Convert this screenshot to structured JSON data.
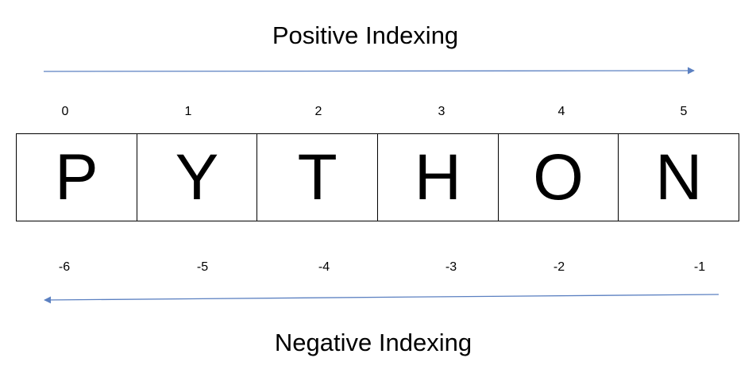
{
  "titles": {
    "top": "Positive Indexing",
    "bottom": "Negative Indexing"
  },
  "letters": [
    "P",
    "Y",
    "T",
    "H",
    "O",
    "N"
  ],
  "positive_indices": [
    "0",
    "1",
    "2",
    "3",
    "4",
    "5"
  ],
  "negative_indices": [
    "-6",
    "-5",
    "-4",
    "-3",
    "-2",
    "-1"
  ],
  "colors": {
    "arrow": "#5b80c1",
    "text": "#000000",
    "border": "#000000"
  }
}
